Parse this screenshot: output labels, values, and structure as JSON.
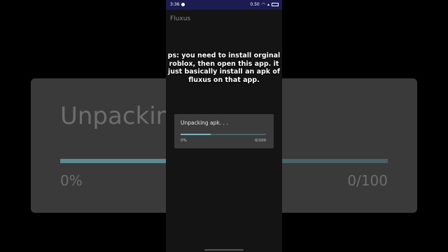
{
  "status_bar": {
    "time": "3:36",
    "icons": [
      "notification-icon",
      "wifi-icon",
      "signal-icon",
      "battery-icon"
    ],
    "speed": "0.50"
  },
  "app": {
    "title": "Fluxus"
  },
  "caption": "ps: you need to install orginal roblox, then open this app. it just basically install an apk of fluxus on that app.",
  "dialog": {
    "title": "Unpacking apk. . .",
    "progress_percent_label": "0%",
    "progress_count_label": "0/100",
    "progress_fill_fraction": 0.35
  },
  "background_zoom": {
    "title": "Unpacking",
    "left_label": "0%",
    "right_label": "0/100"
  },
  "colors": {
    "status_bar": "#1c1c52",
    "dialog_bg": "#3b3b3b",
    "progress_fill": "#7db3ba",
    "progress_track": "#4b6165"
  }
}
